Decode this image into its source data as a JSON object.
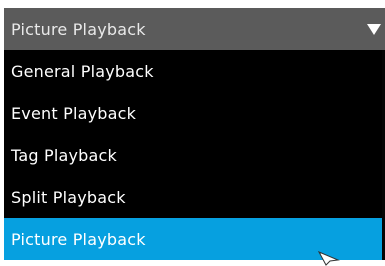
{
  "dropdown": {
    "selected_value": "Picture Playback",
    "options": [
      {
        "label": "General Playback",
        "selected": false
      },
      {
        "label": "Event Playback",
        "selected": false
      },
      {
        "label": "Tag Playback",
        "selected": false
      },
      {
        "label": "Split Playback",
        "selected": false
      },
      {
        "label": "Picture Playback",
        "selected": true
      }
    ],
    "arrow_icon": "caret-down-icon"
  },
  "colors": {
    "header_bg": "#5b5b5b",
    "list_bg": "#000000",
    "selected_bg": "#06a0e0",
    "text": "#ffffff"
  }
}
